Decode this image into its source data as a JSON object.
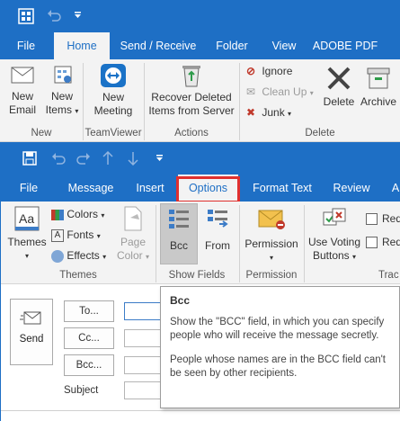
{
  "outer": {
    "tabs": [
      "File",
      "Home",
      "Send / Receive",
      "Folder",
      "View",
      "ADOBE PDF"
    ],
    "active_tab": "Home",
    "new_email": "New Email",
    "new_email_l1": "New",
    "new_email_l2": "Email",
    "new_items_l1": "New",
    "new_items_l2": "Items",
    "group_new": "New",
    "new_meeting_l1": "New",
    "new_meeting_l2": "Meeting",
    "group_teamviewer": "TeamViewer",
    "recover_l1": "Recover Deleted",
    "recover_l2": "Items from Server",
    "group_actions": "Actions",
    "ignore": "Ignore",
    "clean_up": "Clean Up",
    "junk": "Junk",
    "delete": "Delete",
    "archive": "Archive",
    "group_delete": "Delete"
  },
  "inner": {
    "tabs": [
      "File",
      "Message",
      "Insert",
      "Options",
      "Format Text",
      "Review",
      "A"
    ],
    "active_tab": "Options",
    "themes": "Themes",
    "colors": "Colors",
    "fonts": "Fonts",
    "effects": "Effects",
    "page_color_l1": "Page",
    "page_color_l2": "Color",
    "group_themes": "Themes",
    "bcc": "Bcc",
    "from": "From",
    "group_show_fields": "Show Fields",
    "permission": "Permission",
    "group_permission": "Permission",
    "voting_l1": "Use Voting",
    "voting_l2": "Buttons",
    "req1": "Req",
    "req2": "Req",
    "group_tracking": "Trac"
  },
  "compose": {
    "send": "Send",
    "to": "To...",
    "cc": "Cc...",
    "bcc": "Bcc...",
    "subject": "Subject"
  },
  "tooltip": {
    "title": "Bcc",
    "body1": "Show the \"BCC\" field, in which you can specify people who will receive the message secretly.",
    "body2": "People whose names are in the BCC field can't be seen by other recipients."
  },
  "colors": {
    "titlebar": "#1e6fc5",
    "highlight": "#e0302f",
    "ribbon": "#f3f3f3"
  }
}
